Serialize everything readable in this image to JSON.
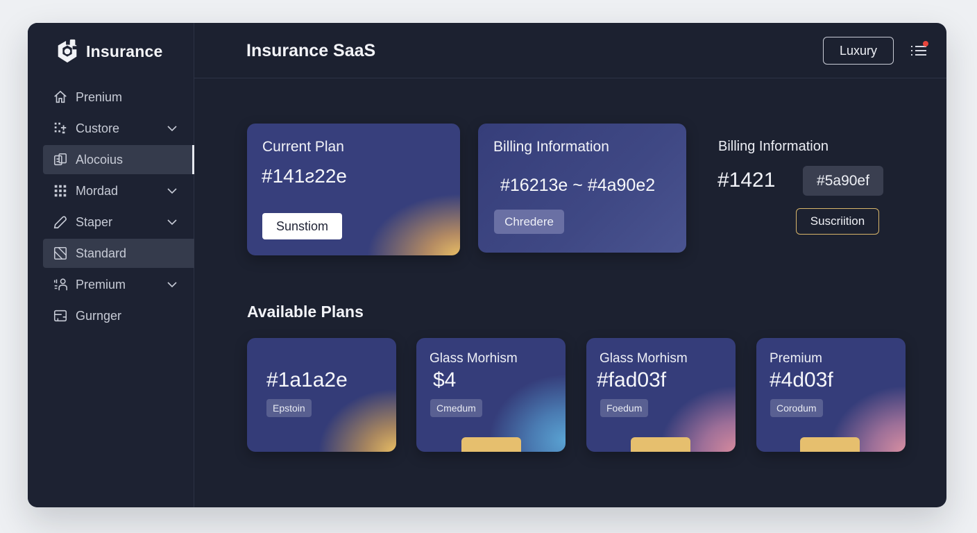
{
  "brand": {
    "name": "Insurance",
    "logo_icon": "hexagon-logo-icon"
  },
  "sidebar": {
    "items": [
      {
        "label": "Prenium",
        "icon": "home-icon",
        "chevron": false,
        "active": false
      },
      {
        "label": "Custore",
        "icon": "grid-plus-icon",
        "chevron": true,
        "active": false
      },
      {
        "label": "Alocoius",
        "icon": "document-copy-icon",
        "chevron": false,
        "active": true
      },
      {
        "label": "Mordad",
        "icon": "dots-grid-icon",
        "chevron": true,
        "active": false
      },
      {
        "label": "Staper",
        "icon": "tag-icon",
        "chevron": true,
        "active": false
      },
      {
        "label": "Standard",
        "icon": "crop-icon",
        "chevron": false,
        "active": true
      },
      {
        "label": "Premium",
        "icon": "people-icon",
        "chevron": true,
        "active": false
      },
      {
        "label": "Gurnger",
        "icon": "card-icon",
        "chevron": false,
        "active": false
      }
    ]
  },
  "header": {
    "title": "Insurance SaaS",
    "luxury_button": "Luxury",
    "menu_icon": "menu-list-icon",
    "notification_color": "#e8453c"
  },
  "current_plan": {
    "title": "Current Plan",
    "value": "#141ƨ22e",
    "button": "Sunstiom"
  },
  "billing_card": {
    "title": "Billing Information",
    "value": "#16213e ~ #4a90e2",
    "button": "Chredere"
  },
  "billing_plain": {
    "title": "Billing Information",
    "value": "#1421",
    "chip": "#5a90ef",
    "button": "Suscriition"
  },
  "available_plans": {
    "title": "Available Plans",
    "plans": [
      {
        "name": "",
        "price": "#1a1a2e",
        "chip": "Epstoin"
      },
      {
        "name": "Glass Morhism",
        "price": "$4",
        "chip": "Cmedum"
      },
      {
        "name": "Glass Morhism",
        "price": "#fad03f",
        "chip": "Foedum"
      },
      {
        "name": "Premium",
        "price": "#4d03f",
        "chip": "Corodum"
      }
    ]
  },
  "colors": {
    "background": "#1c2130",
    "card_blue": "#373f7c",
    "gold": "#e6bf6e",
    "sky": "#5aa3d3",
    "pink": "#d68a9e"
  }
}
